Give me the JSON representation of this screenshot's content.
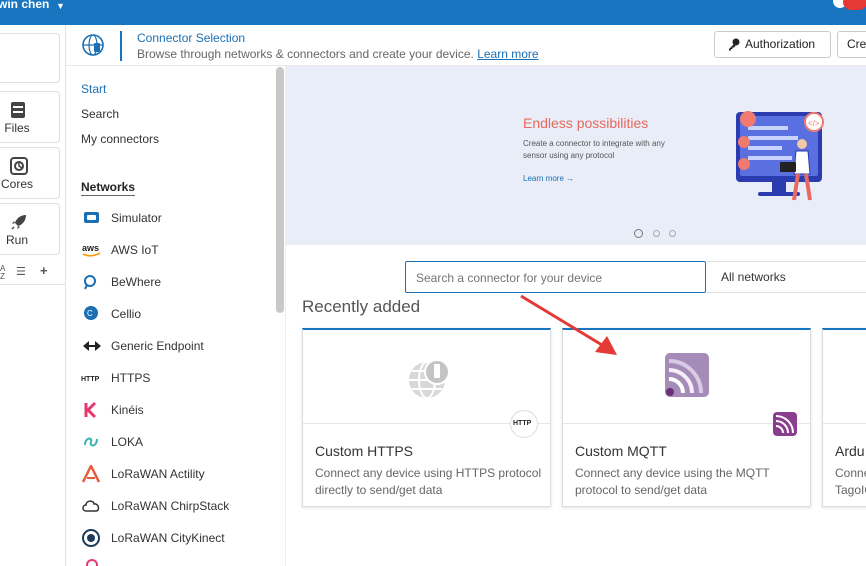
{
  "topbar": {
    "user": "win chen"
  },
  "rail": {
    "files": "Files",
    "cores": "Cores",
    "run": "Run"
  },
  "header": {
    "title": "Connector Selection",
    "subtitle": "Browse through networks & connectors and create your device.",
    "learn_more": "Learn more",
    "authorization": "Authorization",
    "create": "Crea"
  },
  "sidebar": {
    "nav": [
      "Start",
      "Search",
      "My connectors"
    ],
    "networks_heading": "Networks",
    "networks": [
      {
        "label": "Simulator",
        "icon": "simulator-icon"
      },
      {
        "label": "AWS IoT",
        "icon": "aws-icon"
      },
      {
        "label": "BeWhere",
        "icon": "bewhere-icon"
      },
      {
        "label": "Cellio",
        "icon": "cellio-icon"
      },
      {
        "label": "Generic Endpoint",
        "icon": "generic-endpoint-icon"
      },
      {
        "label": "HTTPS",
        "icon": "https-icon"
      },
      {
        "label": "Kinéis",
        "icon": "kineis-icon"
      },
      {
        "label": "LOKA",
        "icon": "loka-icon"
      },
      {
        "label": "LoRaWAN Actility",
        "icon": "actility-icon"
      },
      {
        "label": "LoRaWAN ChirpStack",
        "icon": "chirpstack-icon"
      },
      {
        "label": "LoRaWAN CityKinect",
        "icon": "citykinect-icon"
      }
    ]
  },
  "banner": {
    "heading": "Endless possibilities",
    "text": "Create a connector to integrate with any sensor using any protocol",
    "link": "Learn more",
    "slides": 3,
    "active_slide": 1
  },
  "search": {
    "placeholder": "Search a connector for your device",
    "filter": "All networks"
  },
  "recent": {
    "heading": "Recently added",
    "cards": [
      {
        "name": "Custom HTTPS",
        "desc": "Connect any device using HTTPS protocol directly to send/get data",
        "badge": "HTTP"
      },
      {
        "name": "Custom MQTT",
        "desc": "Connect any device using the MQTT protocol to send/get data"
      },
      {
        "name": "Ardu",
        "desc": "Conne TagoIO"
      }
    ]
  },
  "colors": {
    "primary": "#1a75c0",
    "banner_bg": "#e8edf7",
    "accent": "#e8695f",
    "mqtt": "#8a3e8f"
  }
}
